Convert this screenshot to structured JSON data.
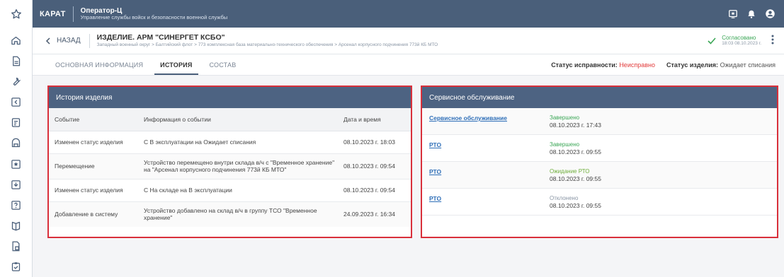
{
  "topbar": {
    "brand": "КАРАТ",
    "app_name": "Оператор-Ц",
    "app_subtitle": "Управление службы войск и безопасности военной службы"
  },
  "header": {
    "back_label": "НАЗАД",
    "item_title": "ИЗДЕЛИЕ. АРМ \"СИНЕРГЕТ КСБО\"",
    "breadcrumb": "Западный военный округ  >  Балтийский флот  >  773 комплексная база материально-технического обеспечения  >  Арсенал корпусного подчинения 773й КБ МТО",
    "approval_status": "Согласовано",
    "approval_date": "18:03 08.10.2023 г."
  },
  "tabs": [
    {
      "label": "ОСНОВНАЯ ИНФОРМАЦИЯ"
    },
    {
      "label": "ИСТОРИЯ"
    },
    {
      "label": "СОСТАВ"
    }
  ],
  "status": {
    "health_label": "Статус исправности:",
    "health_value": "Неисправно",
    "item_label": "Статус изделия:",
    "item_value": "Ожидает списания"
  },
  "history": {
    "title": "История изделия",
    "columns": [
      "Событие",
      "Информация о событии",
      "Дата и время"
    ],
    "rows": [
      {
        "event": "Изменен статус изделия",
        "info": "С В эксплуатации на Ожидает списания",
        "date": "08.10.2023 г. 18:03"
      },
      {
        "event": "Перемещение",
        "info": "Устройство перемещено внутри склада в/ч с \"Временное хранение\" на \"Арсенал корпусного подчинения 773й КБ МТО\"",
        "date": "08.10.2023 г. 09:54"
      },
      {
        "event": "Изменен статус изделия",
        "info": "С На складе на В эксплуатации",
        "date": "08.10.2023 г. 09:54"
      },
      {
        "event": "Добавление в систему",
        "info": "Устройство добавлено на склад в/ч в группу ТСО \"Временное хранение\"",
        "date": "24.09.2023 г. 16:34"
      }
    ]
  },
  "service": {
    "title": "Сервисное обслуживание",
    "rows": [
      {
        "link": "Сервисное обслуживание",
        "state": "Завершено",
        "date": "08.10.2023 г. 17:43"
      },
      {
        "link": "РТО",
        "state": "Завершено",
        "date": "08.10.2023 г. 09:55"
      },
      {
        "link": "РТО",
        "state": "Ожидание РТО",
        "date": "08.10.2023 г. 09:55"
      },
      {
        "link": "РТО",
        "state": "Отклонено",
        "date": "08.10.2023 г. 09:55"
      }
    ]
  },
  "colors": {
    "topbar": "#4a5f7a",
    "panel_header": "#4d6382",
    "highlight_border": "#d9303b",
    "success": "#3aa655",
    "error": "#e23b3b",
    "link": "#2f6fb8"
  },
  "icons": {
    "topbar": [
      "star-icon",
      "monitor-icon",
      "bell-icon",
      "user-icon"
    ],
    "sidebar": [
      "home-icon",
      "document-icon",
      "wrench-icon",
      "inbox-icon",
      "checklist-icon",
      "archive-icon",
      "star-box-icon",
      "download-box-icon",
      "help-box-icon",
      "book-icon",
      "report-icon",
      "clipboard-icon"
    ]
  }
}
